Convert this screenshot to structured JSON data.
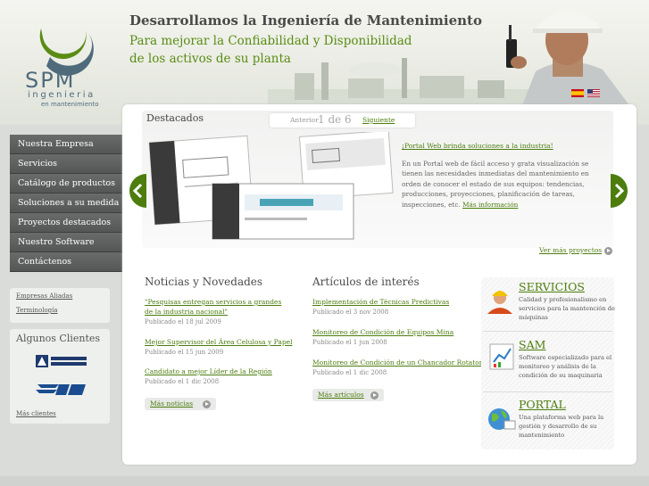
{
  "brand": {
    "name": "SPM",
    "sub1": "ingenieria",
    "sub2": "en mantenimiento",
    "accent": "#5a8c14",
    "nav_bg": "#5e605f"
  },
  "header": {
    "tagline": "Desarrollamos la Ingeniería de Mantenimiento",
    "tagline2": "Para mejorar la Confiabilidad y Disponibilidad",
    "tagline3": "de los activos de su planta"
  },
  "nav": {
    "items": [
      {
        "label": "Nuestra Empresa"
      },
      {
        "label": "Servicios"
      },
      {
        "label": "Catálogo de productos"
      },
      {
        "label": "Soluciones a su medida"
      },
      {
        "label": "Proyectos destacados"
      },
      {
        "label": "Nuestro Software"
      },
      {
        "label": "Contáctenos"
      }
    ]
  },
  "links": {
    "allied": "Empresas Aliadas",
    "terms": "Terminología"
  },
  "clients": {
    "title": "Algunos Clientes",
    "more": "Más clientes",
    "logos": [
      "anglo-american-logo",
      "enap-logo"
    ]
  },
  "featured": {
    "title": "Destacados",
    "prev": "Anterior",
    "page": "1 de 6",
    "next": "Siguiente",
    "link": "¡Portal Web brinda soluciones a la industria!",
    "text": "En un Portal web de fácil acceso y grata visualización se tienen las necesidades inmediatas del mantenimiento en orden de conocer el estado de sus equipos: tendencias, producciones, proyecciones, planificación de tareas, inspecciones, etc.",
    "more": "Más información",
    "projects": "Ver más proyectos"
  },
  "news": {
    "title": "Noticias y Novedades",
    "items": [
      {
        "title": "\"Pesquisas entregan servicios a grandes de la industria nacional\"",
        "date": "Publicado el 18 jul 2009"
      },
      {
        "title": "Mejor Supervisor del Área Celulosa y Papel",
        "date": "Publicado el 15 jun 2009"
      },
      {
        "title": "Candidato a mejor Líder de la Región",
        "date": "Publicado el 1 dic 2008"
      }
    ],
    "more": "Más noticias"
  },
  "articles": {
    "title": "Artículos de interés",
    "items": [
      {
        "title": "Implementación de Técnicas Predictivas",
        "date": "Publicado el 3 nov 2008"
      },
      {
        "title": "Monitoreo de Condición de Equipos Mina",
        "date": "Publicado el 1 jun 2008"
      },
      {
        "title": "Monitoreo de Condición de un Chancador Rotatorio",
        "date": "Publicado el 1 dic 2008"
      }
    ],
    "more": "Más artículos"
  },
  "services": {
    "items": [
      {
        "title": "SERVICIOS",
        "text": "Calidad y profesionalismo en servicios para la mantención de máquinas",
        "icon": "engineer-icon"
      },
      {
        "title": "SAM",
        "text": "Software especializado para el monitoreo y análisis de la condición de su maquinaria",
        "icon": "chart-icon"
      },
      {
        "title": "PORTAL",
        "text": "Una plataforma web para la gestión y desarrollo de su mantenimiento",
        "icon": "globe-icon"
      }
    ]
  }
}
